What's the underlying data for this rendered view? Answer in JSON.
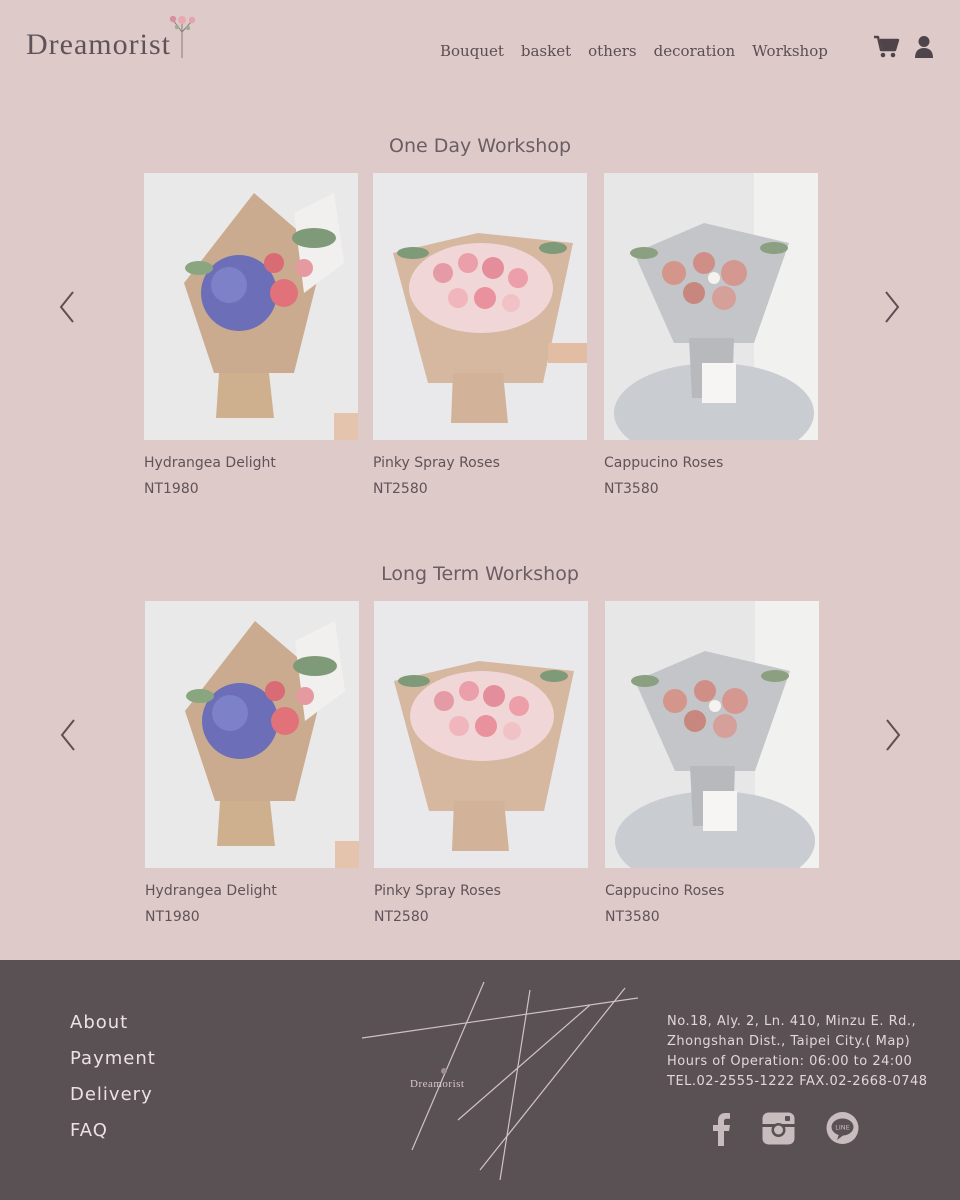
{
  "brand": {
    "logo_text": "Dreamorist"
  },
  "nav": {
    "items": [
      "Bouquet",
      "basket",
      "others",
      "decoration",
      "Workshop"
    ]
  },
  "icons": {
    "cart": "cart-icon",
    "user": "user-icon"
  },
  "sections": [
    {
      "title": "One Day Workshop",
      "products": [
        {
          "name": "Hydrangea Delight",
          "price": "NT1980"
        },
        {
          "name": "Pinky Spray Roses",
          "price": "NT2580"
        },
        {
          "name": "Cappucino Roses",
          "price": "NT3580"
        }
      ]
    },
    {
      "title": "Long Term Workshop",
      "products": [
        {
          "name": "Hydrangea Delight",
          "price": "NT1980"
        },
        {
          "name": "Pinky Spray Roses",
          "price": "NT2580"
        },
        {
          "name": "Cappucino Roses",
          "price": "NT3580"
        }
      ]
    }
  ],
  "footer": {
    "links": [
      "About",
      "Payment",
      "Delivery",
      "FAQ"
    ],
    "logo_text": "Dreamorist",
    "address_line1": "No.18, Aly. 2, Ln. 410, Minzu E. Rd.,",
    "address_line2": "Zhongshan Dist., Taipei City.( Map)",
    "hours": "Hours of Operation: 06:00 to 24:00",
    "contact": "TEL.02-2555-1222 FAX.02-2668-0748",
    "social_icons": [
      "facebook-icon",
      "instagram-icon",
      "line-icon"
    ],
    "line_label": "LINE"
  },
  "colors": {
    "background": "#dfcaca",
    "footer": "#5a5155",
    "text": "#5a4e53"
  }
}
